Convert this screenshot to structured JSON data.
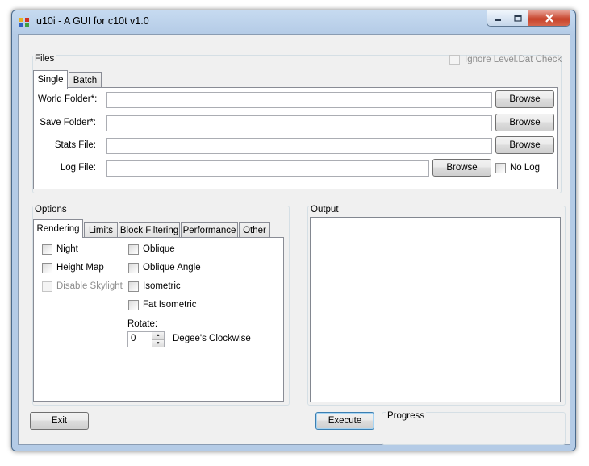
{
  "window": {
    "title": "u10i - A GUI for c10t v1.0"
  },
  "files": {
    "legend": "Files",
    "ignore_check_label": "Ignore Level.Dat Check",
    "tabs": [
      {
        "label": "Single"
      },
      {
        "label": "Batch"
      }
    ],
    "fields": {
      "world_folder": {
        "label": "World Folder*:",
        "value": "",
        "browse": "Browse"
      },
      "save_folder": {
        "label": "Save Folder*:",
        "value": "",
        "browse": "Browse"
      },
      "stats_file": {
        "label": "Stats File:",
        "value": "",
        "browse": "Browse"
      },
      "log_file": {
        "label": "Log File:",
        "value": "",
        "browse": "Browse"
      }
    },
    "no_log_label": "No Log"
  },
  "options": {
    "legend": "Options",
    "tabs": [
      {
        "label": "Rendering"
      },
      {
        "label": "Limits"
      },
      {
        "label": "Block Filtering"
      },
      {
        "label": "Performance"
      },
      {
        "label": "Other"
      }
    ],
    "checks": {
      "night": "Night",
      "height_map": "Height Map",
      "disable_skylight": "Disable Skylight",
      "oblique": "Oblique",
      "oblique_angle": "Oblique Angle",
      "isometric": "Isometric",
      "fat_isometric": "Fat Isometric"
    },
    "rotate": {
      "label": "Rotate:",
      "value": "0",
      "suffix": "Degee's Clockwise"
    }
  },
  "output": {
    "legend": "Output",
    "text": ""
  },
  "buttons": {
    "exit": "Exit",
    "execute": "Execute"
  },
  "progress": {
    "legend": "Progress",
    "value": 0
  }
}
